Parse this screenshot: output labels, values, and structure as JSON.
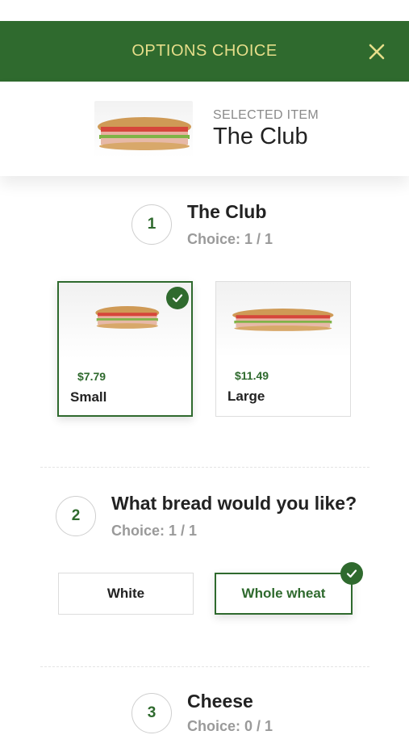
{
  "header": {
    "title": "OPTIONS CHOICE"
  },
  "selected": {
    "label": "SELECTED ITEM",
    "name": "The Club"
  },
  "steps": [
    {
      "number": "1",
      "title": "The Club",
      "choice": "Choice: 1 / 1"
    },
    {
      "number": "2",
      "title": "What bread would you like?",
      "choice": "Choice: 1 / 1"
    },
    {
      "number": "3",
      "title": "Cheese",
      "choice": "Choice: 0 / 1"
    }
  ],
  "sizes": [
    {
      "price": "$7.79",
      "name": "Small",
      "selected": true
    },
    {
      "price": "$11.49",
      "name": "Large",
      "selected": false
    }
  ],
  "breads": [
    {
      "label": "White",
      "selected": false
    },
    {
      "label": "Whole wheat",
      "selected": true
    }
  ],
  "colors": {
    "accent": "#2f6a2e",
    "header_text": "#e6de8a"
  }
}
